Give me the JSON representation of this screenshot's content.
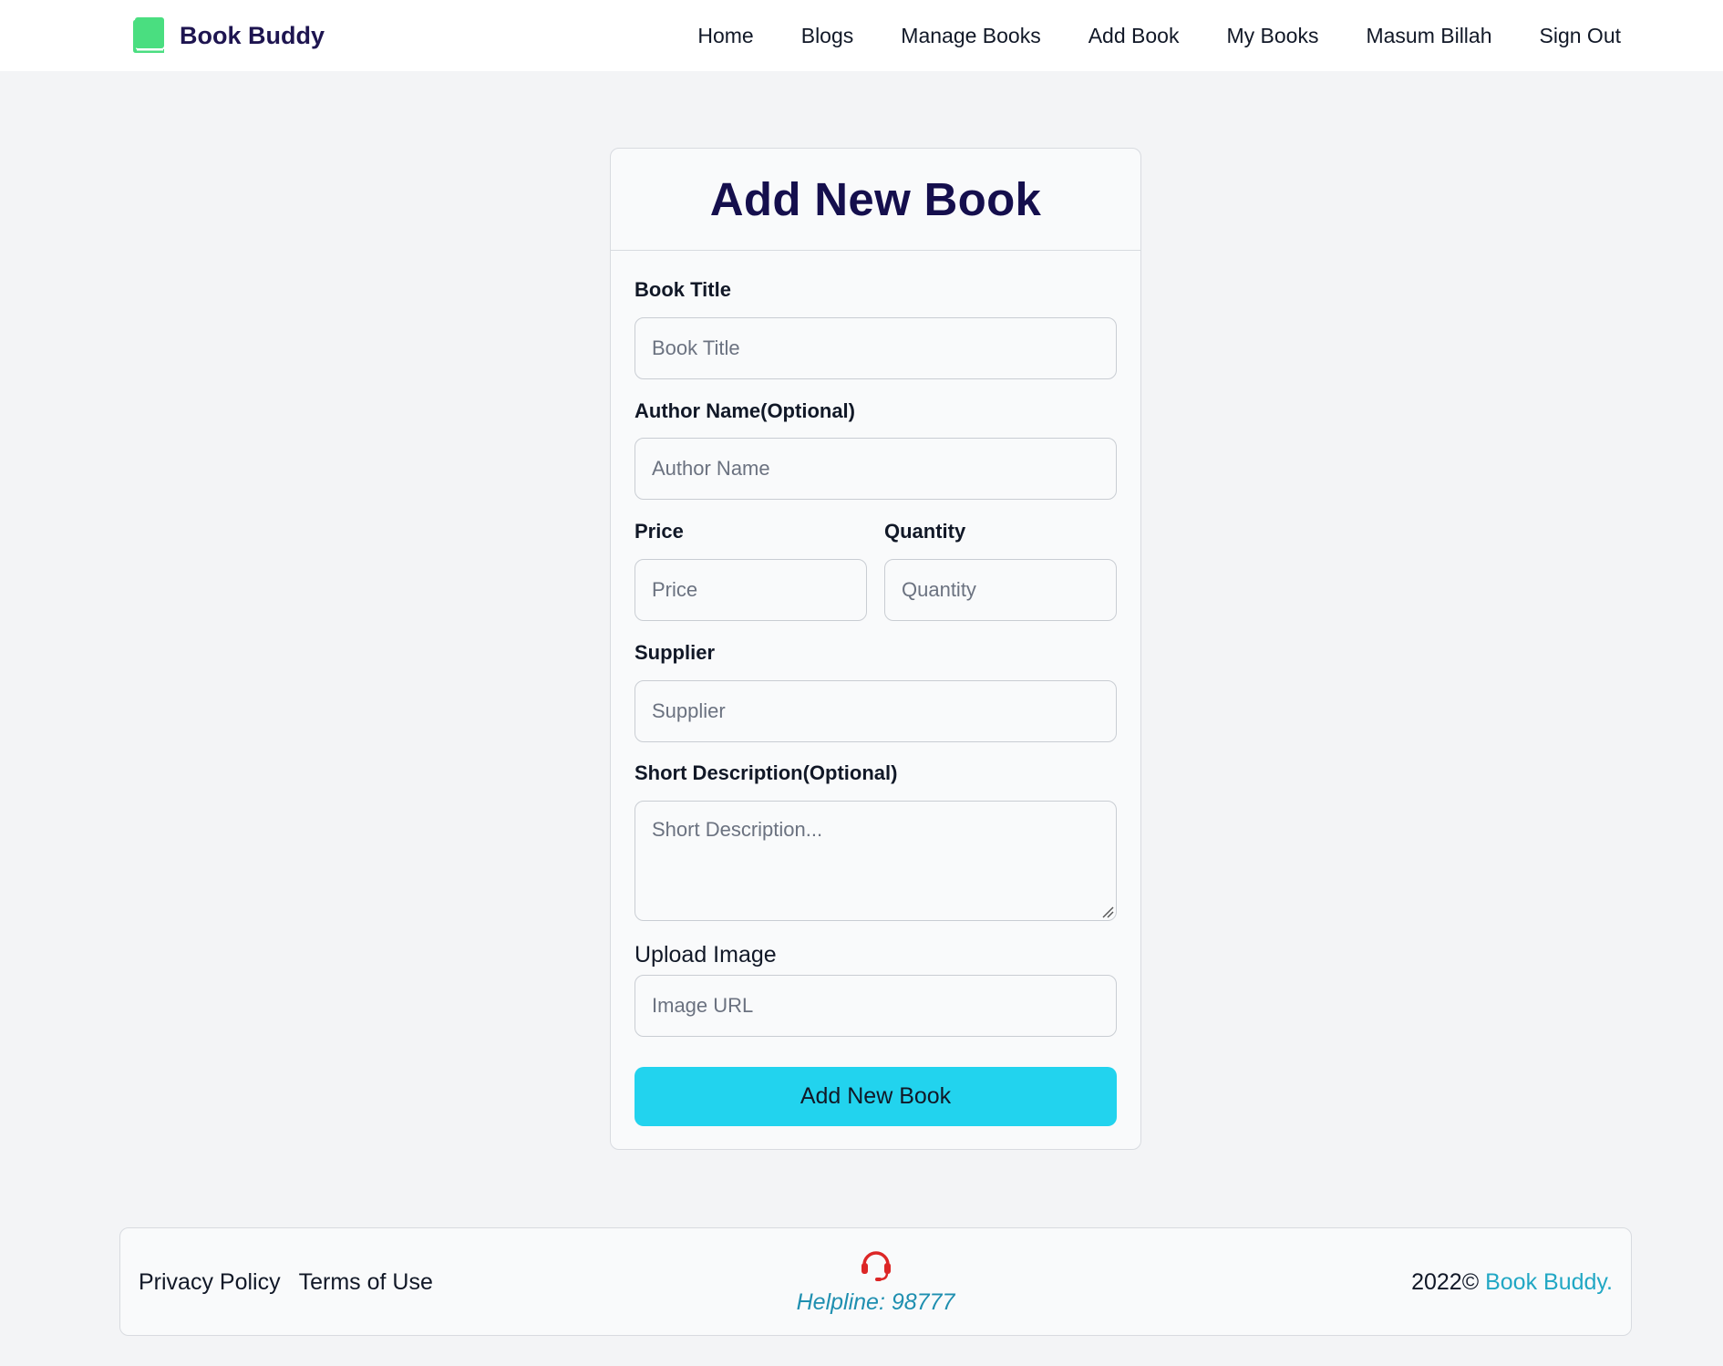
{
  "navbar": {
    "brand_name": "Book Buddy",
    "brand_icon": "book-icon",
    "brand_color": "#4ade80",
    "links": [
      "Home",
      "Blogs",
      "Manage Books",
      "Add Book",
      "My Books",
      "Masum Billah",
      "Sign Out"
    ]
  },
  "form": {
    "title": "Add New Book",
    "fields": {
      "book_title": {
        "label": "Book Title",
        "placeholder": "Book Title",
        "value": ""
      },
      "author_name": {
        "label": "Author Name(Optional)",
        "placeholder": "Author Name",
        "value": ""
      },
      "price": {
        "label": "Price",
        "placeholder": "Price",
        "value": ""
      },
      "quantity": {
        "label": "Quantity",
        "placeholder": "Quantity",
        "value": ""
      },
      "supplier": {
        "label": "Supplier",
        "placeholder": "Supplier",
        "value": ""
      },
      "short_description": {
        "label": "Short Description(Optional)",
        "placeholder": "Short Description...",
        "value": ""
      },
      "image_url": {
        "label": "Upload Image",
        "placeholder": "Image URL",
        "value": ""
      }
    },
    "submit_label": "Add New Book",
    "submit_color": "#22d3ee"
  },
  "footer": {
    "links": [
      "Privacy Policy",
      "Terms of Use"
    ],
    "helpline_icon": "headset-icon",
    "helpline_icon_color": "#dc2626",
    "helpline_text": "Helpline: 98777",
    "copyright_year": "2022©",
    "copyright_brand": "Book Buddy."
  }
}
